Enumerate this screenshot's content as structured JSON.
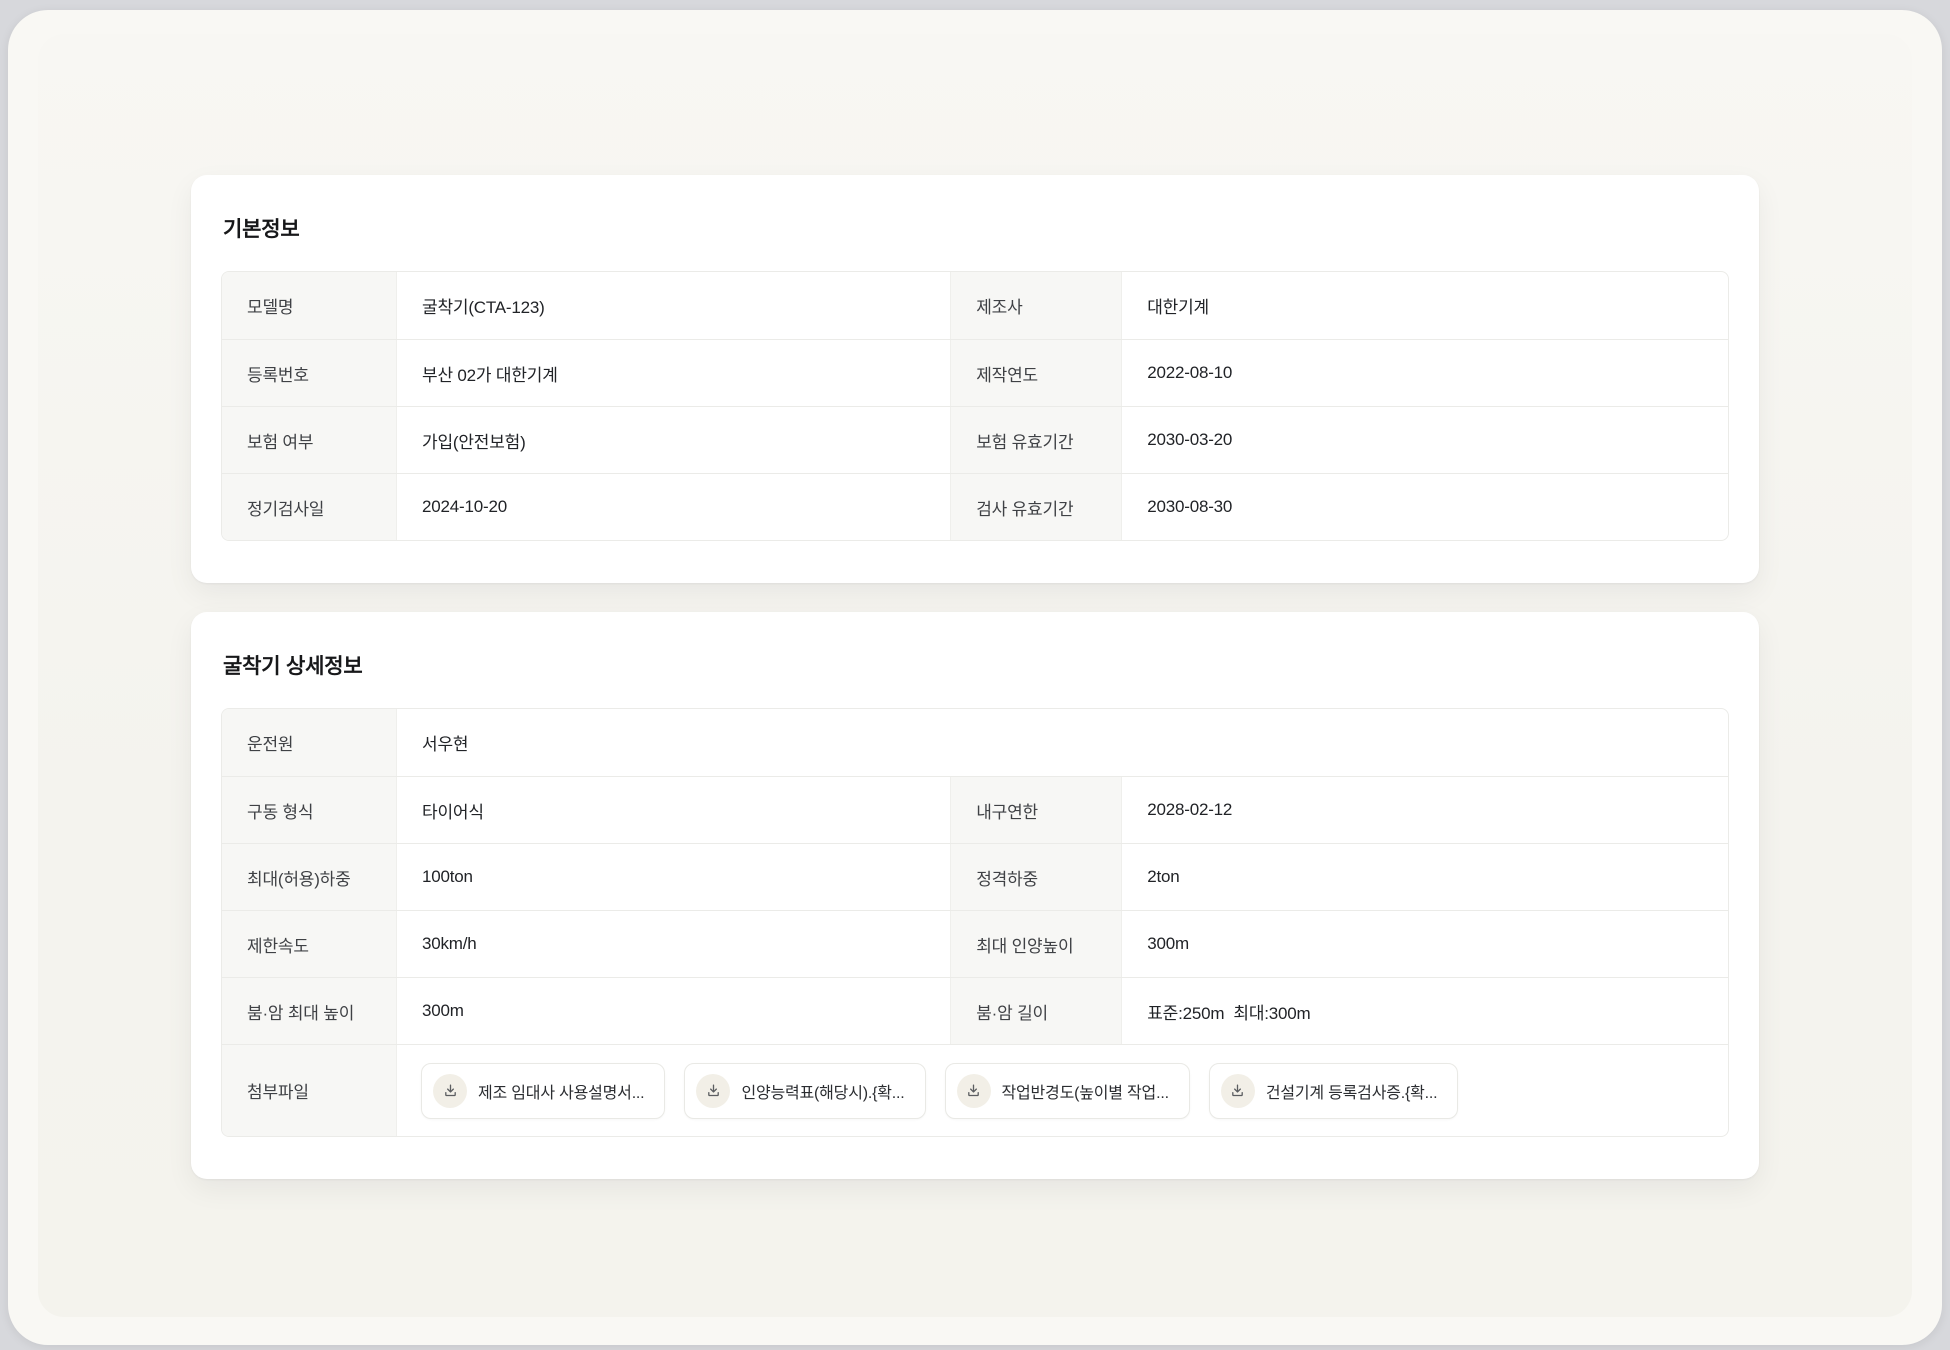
{
  "colors": {
    "page_background": "#d7d8dc",
    "frame_background": "#f9f8f4",
    "panel_background": "#f4f3ee",
    "card_background": "#ffffff",
    "label_cell_background": "#f7f7f5",
    "table_border": "#ebebe8",
    "label_text": "#3f4145",
    "value_text": "#212327",
    "title_text": "#17181a",
    "file_icon_background": "#f2efe7"
  },
  "card_basic": {
    "title": "기본정보",
    "rows": [
      {
        "l1": "모델명",
        "v1": "굴착기(CTA-123)",
        "l2": "제조사",
        "v2": "대한기계"
      },
      {
        "l1": "등록번호",
        "v1": "부산 02가 대한기계",
        "l2": "제작연도",
        "v2": "2022-08-10"
      },
      {
        "l1": "보험 여부",
        "v1": "가입(안전보험)",
        "l2": "보험 유효기간",
        "v2": "2030-03-20"
      },
      {
        "l1": "정기검사일",
        "v1": "2024-10-20",
        "l2": "검사 유효기간",
        "v2": "2030-08-30"
      }
    ]
  },
  "card_detail": {
    "title": "굴착기 상세정보",
    "operator_row": {
      "label": "운전원",
      "value": "서우현"
    },
    "rows": [
      {
        "l1": "구동 형식",
        "v1": "타이어식",
        "l2": "내구연한",
        "v2": "2028-02-12"
      },
      {
        "l1": "최대(허용)하중",
        "v1": "100ton",
        "l2": "정격하중",
        "v2": "2ton"
      },
      {
        "l1": "제한속도",
        "v1": "30km/h",
        "l2": "최대 인양높이",
        "v2": "300m"
      },
      {
        "l1": "붐·암 최대 높이",
        "v1": "300m",
        "l2": "붐·암 길이",
        "v2": "표준:250m  최대:300m"
      }
    ],
    "attachment_row": {
      "label": "첨부파일",
      "files": [
        {
          "name": "제조 임대사 사용설명서...",
          "icon": "download-icon"
        },
        {
          "name": "인양능력표(해당시).{확...",
          "icon": "download-icon"
        },
        {
          "name": "작업반경도(높이별 작업...",
          "icon": "download-icon"
        },
        {
          "name": "건설기계 등록검사증.{확...",
          "icon": "download-icon"
        }
      ]
    }
  }
}
